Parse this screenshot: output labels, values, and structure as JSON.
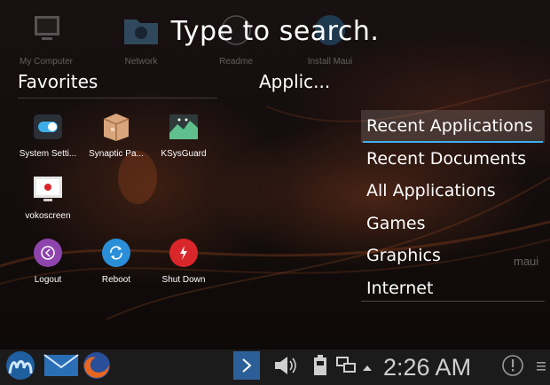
{
  "search": {
    "prompt": "Type to search."
  },
  "desktop_icons": [
    {
      "label": "My Computer",
      "icon": "computer-icon"
    },
    {
      "label": "Network",
      "icon": "network-folder-icon"
    },
    {
      "label": "Readme",
      "icon": "readme-icon"
    },
    {
      "label": "Install Maui",
      "icon": "install-icon"
    }
  ],
  "favorites": {
    "title": "Favorites",
    "items": [
      {
        "label": "System Setti...",
        "icon": "settings-toggle-icon"
      },
      {
        "label": "Synaptic Pa...",
        "icon": "package-box-icon"
      },
      {
        "label": "KSysGuard",
        "icon": "system-monitor-icon"
      },
      {
        "label": "vokoscreen",
        "icon": "screen-recorder-icon"
      }
    ],
    "session": [
      {
        "label": "Logout",
        "icon": "logout-icon",
        "color": "#8e44ad"
      },
      {
        "label": "Reboot",
        "icon": "reboot-icon",
        "color": "#2a8fd8"
      },
      {
        "label": "Shut Down",
        "icon": "power-icon",
        "color": "#d9262b"
      }
    ]
  },
  "applications": {
    "title": "Applic...",
    "categories": [
      {
        "label": "Recent Applications",
        "active": true
      },
      {
        "label": "Recent Documents",
        "active": false
      },
      {
        "label": "All Applications",
        "active": false
      },
      {
        "label": "Games",
        "active": false
      },
      {
        "label": "Graphics",
        "active": false
      },
      {
        "label": "Internet",
        "active": false
      }
    ]
  },
  "wallpaper": {
    "brand": "maui"
  },
  "taskbar": {
    "clock": "2:26 AM",
    "items": [
      "maui-launcher-icon",
      "mail-icon",
      "firefox-icon",
      "pager-icon",
      "volume-icon",
      "battery-icon",
      "network-monitor-icon",
      "tray-expand-icon",
      "notifications-icon",
      "menu-icon"
    ]
  },
  "colors": {
    "accent": "#3daee9",
    "taskbar": "#1c1b1c"
  }
}
